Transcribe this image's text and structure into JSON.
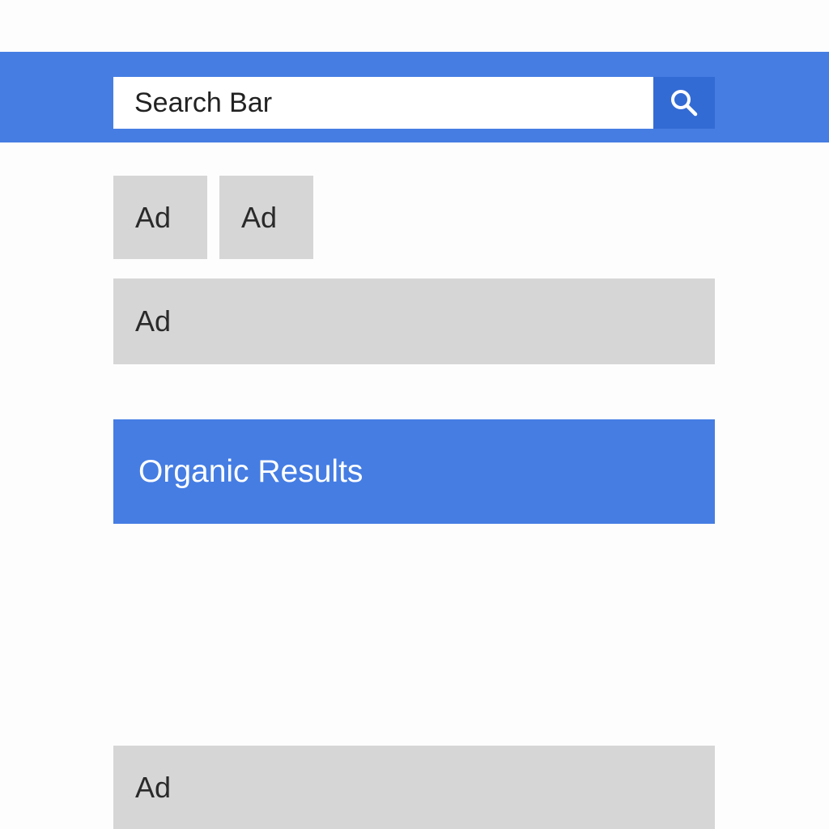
{
  "search": {
    "label": "Search Bar",
    "button_icon": "search-icon"
  },
  "ads": {
    "small_1": "Ad",
    "small_2": "Ad",
    "wide_1": "Ad",
    "wide_2": "Ad"
  },
  "organic": {
    "label": "Organic Results"
  },
  "colors": {
    "header": "#457de3",
    "search_button": "#336bd4",
    "ad_block": "#d6d6d6",
    "organic_block": "#457de3"
  }
}
